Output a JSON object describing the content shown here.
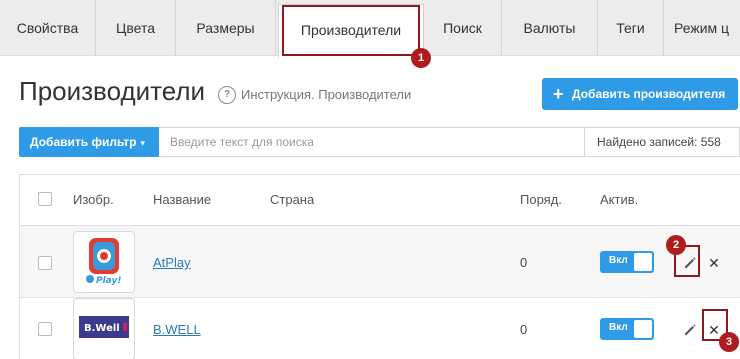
{
  "tabs": [
    {
      "label": "Свойства"
    },
    {
      "label": "Цвета"
    },
    {
      "label": "Размеры"
    },
    {
      "label": "Производители",
      "active": true
    },
    {
      "label": "Поиск"
    },
    {
      "label": "Валюты"
    },
    {
      "label": "Теги"
    },
    {
      "label": "Режим ц"
    }
  ],
  "markers": [
    "1",
    "2",
    "3"
  ],
  "page": {
    "title": "Производители",
    "help_text": "Инструкция. Производители",
    "add_button": "Добавить производителя",
    "add_icon": "+"
  },
  "filter": {
    "button_label": "Добавить фильтр",
    "caret": "▾",
    "search_placeholder": "Введите текст для поиска",
    "found_text": "Найдено записей: 558"
  },
  "table": {
    "headers": {
      "image": "Изобр.",
      "name": "Название",
      "country": "Страна",
      "order": "Поряд.",
      "active": "Актив."
    },
    "rows": [
      {
        "name": "AtPlay",
        "order": "0",
        "active_label": "Вкл",
        "logo_text": "Play!"
      },
      {
        "name": "B.WELL",
        "order": "0",
        "active_label": "Вкл",
        "logo_text": "B.Well"
      }
    ]
  },
  "colors": {
    "accent": "#2f9be6",
    "highlight": "#b01c1c",
    "link": "#2a7ab8"
  },
  "icons": {
    "help": "?",
    "edit": "pencil-icon",
    "delete": "✕"
  }
}
